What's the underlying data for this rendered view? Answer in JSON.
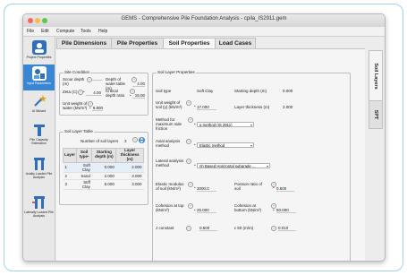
{
  "app": {
    "title": "GEMS - Comprehensive Pile Foundation Analysis - cpila_IS2911.gem",
    "traffic_colors": [
      "#ee6a5f",
      "#f5bd4f",
      "#61c454"
    ]
  },
  "menu": [
    "File",
    "Edit",
    "Compute",
    "Tools",
    "Help"
  ],
  "sidebar": [
    {
      "label": "Project Properties",
      "icon": "project-icon"
    },
    {
      "label": "Input Parameters",
      "icon": "input-parameters-icon"
    },
    {
      "label": "AI Wizard",
      "icon": "wizard-icon"
    },
    {
      "label": "Pile Capacity Estimation",
      "icon": "pile-capacity-icon"
    },
    {
      "label": "Axially Loaded Pile Analysis",
      "icon": "axial-pile-icon"
    },
    {
      "label": "Laterally Loaded Pile Analysis",
      "icon": "lateral-pile-icon"
    }
  ],
  "tabs": [
    "Pile Dimensions",
    "Pile Properties",
    "Soil Properties",
    "Load Cases"
  ],
  "active_tab": "Soil Properties",
  "right_tabs": [
    "Soil Layers",
    "SPT"
  ],
  "site_condition": {
    "title": "Site Condition",
    "scour_label": "Scour depth (m)",
    "scour_value": "",
    "water_table_label": "Depth of water table (m)",
    "water_table_value": "4.00",
    "zeta_label": "Zeta (C)",
    "zeta_value": "4.00",
    "critical_label": "Critical depth ratio",
    "critical_value": "15.00",
    "unit_water_label": "Unit weight of water (kN/m³)",
    "unit_water_value": "9.800"
  },
  "soil_layer_table": {
    "title": "Soil Layer Table",
    "num_label": "Number of soil layers",
    "num_value": "3",
    "headers": [
      "Layer",
      "Soil type",
      "Starting depth (m)",
      "Layer thickness (m)"
    ],
    "rows": [
      [
        "1",
        "Soft Clay",
        "0.000",
        "2.000"
      ],
      [
        "2",
        "Sand",
        "2.000",
        "3.000"
      ],
      [
        "3",
        "Stiff Clay",
        "5.000",
        "3.000"
      ]
    ]
  },
  "soil_layer_properties": {
    "title": "Soil Layer Properties",
    "soil_type_label": "Soil type",
    "soil_type_value": "Soft Clay",
    "starting_depth_label": "Starting depth (m)",
    "starting_depth_value": "0.000",
    "unit_weight_label": "Unit weight of soil (γ) (kN/m³)",
    "unit_weight_value": "17.000",
    "layer_thickness_label": "Layer thickness (m)",
    "layer_thickness_value": "2.000",
    "method_label": "Method for maximum side friction",
    "method_value": "α method (IS 2911)",
    "axial_label": "Axial analysis method",
    "axial_value": "Elastic method",
    "lateral_label": "Lateral analysis method",
    "lateral_value": "nh Based Horizontal subgrade ...",
    "elastic_label": "Elastic modulus of soil (kN/m²)",
    "elastic_value": "3000.0",
    "poisson_label": "Poisson ratio of soil",
    "poisson_value": "0.500",
    "cohesion_top_label": "Cohesion at top (kN/m²)",
    "cohesion_top_value": "25.000",
    "cohesion_bottom_label": "Cohesion at bottom (kN/m²)",
    "cohesion_bottom_value": "50.000",
    "j_label": "J constant",
    "j_value": "0.500",
    "e50_label": "ε 50 (m/m)",
    "e50_value": "0.010"
  }
}
